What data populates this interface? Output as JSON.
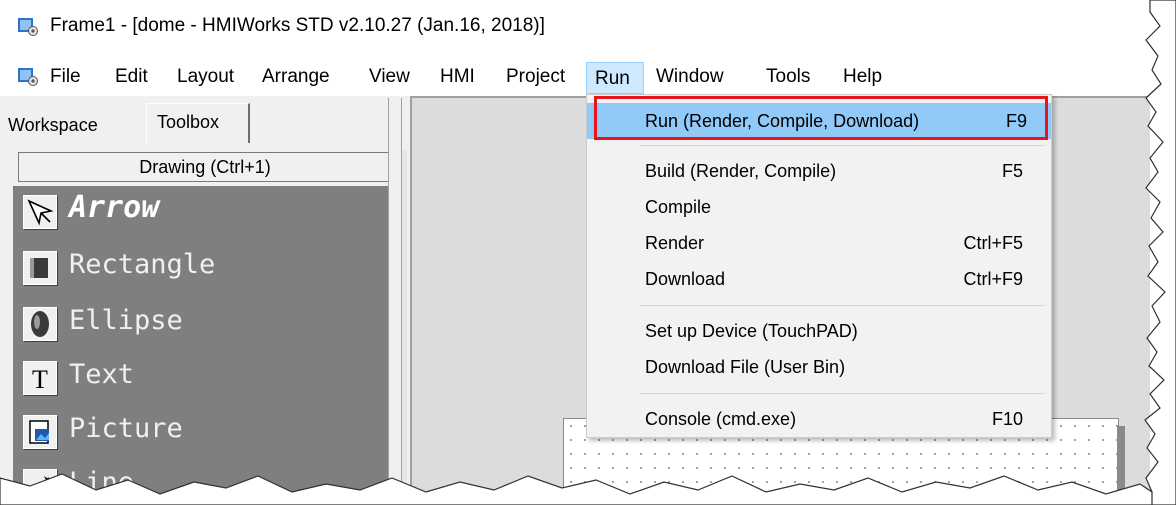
{
  "window": {
    "title": "Frame1 - [dome - HMIWorks STD v2.10.27 (Jan.16, 2018)]"
  },
  "menubar": {
    "items": [
      "File",
      "Edit",
      "Layout",
      "Arrange",
      "View",
      "HMI",
      "Project",
      "Run",
      "Window",
      "Tools",
      "Help"
    ],
    "active": "Run"
  },
  "left_panel": {
    "tabs": [
      "Workspace",
      "Toolbox"
    ],
    "active_tab": "Toolbox",
    "section_header": "Drawing (Ctrl+1)",
    "tools": [
      {
        "label": "Arrow",
        "icon": "arrow-cursor-icon",
        "selected": true
      },
      {
        "label": "Rectangle",
        "icon": "rectangle-icon",
        "selected": false
      },
      {
        "label": "Ellipse",
        "icon": "ellipse-icon",
        "selected": false
      },
      {
        "label": "Text",
        "icon": "text-icon",
        "selected": false
      },
      {
        "label": "Picture",
        "icon": "picture-icon",
        "selected": false
      },
      {
        "label": "Line",
        "icon": "line-icon",
        "selected": false
      }
    ]
  },
  "run_menu": {
    "items": [
      {
        "label": "Run (Render, Compile, Download)",
        "shortcut": "F9",
        "highlighted": true
      },
      {
        "label": "Build (Render, Compile)",
        "shortcut": "F5"
      },
      {
        "label": "Compile",
        "shortcut": ""
      },
      {
        "label": "Render",
        "shortcut": "Ctrl+F5"
      },
      {
        "label": "Download",
        "shortcut": "Ctrl+F9"
      },
      {
        "label": "Set up Device (TouchPAD)",
        "shortcut": ""
      },
      {
        "label": "Download File (User Bin)",
        "shortcut": ""
      },
      {
        "label": "Console (cmd.exe)",
        "shortcut": "F10"
      }
    ]
  },
  "colors": {
    "highlight": "#91c9f7",
    "callout_border": "#e8141c",
    "toolbox_bg": "#7f7f7f",
    "canvas_bg": "#dcdcdc"
  }
}
